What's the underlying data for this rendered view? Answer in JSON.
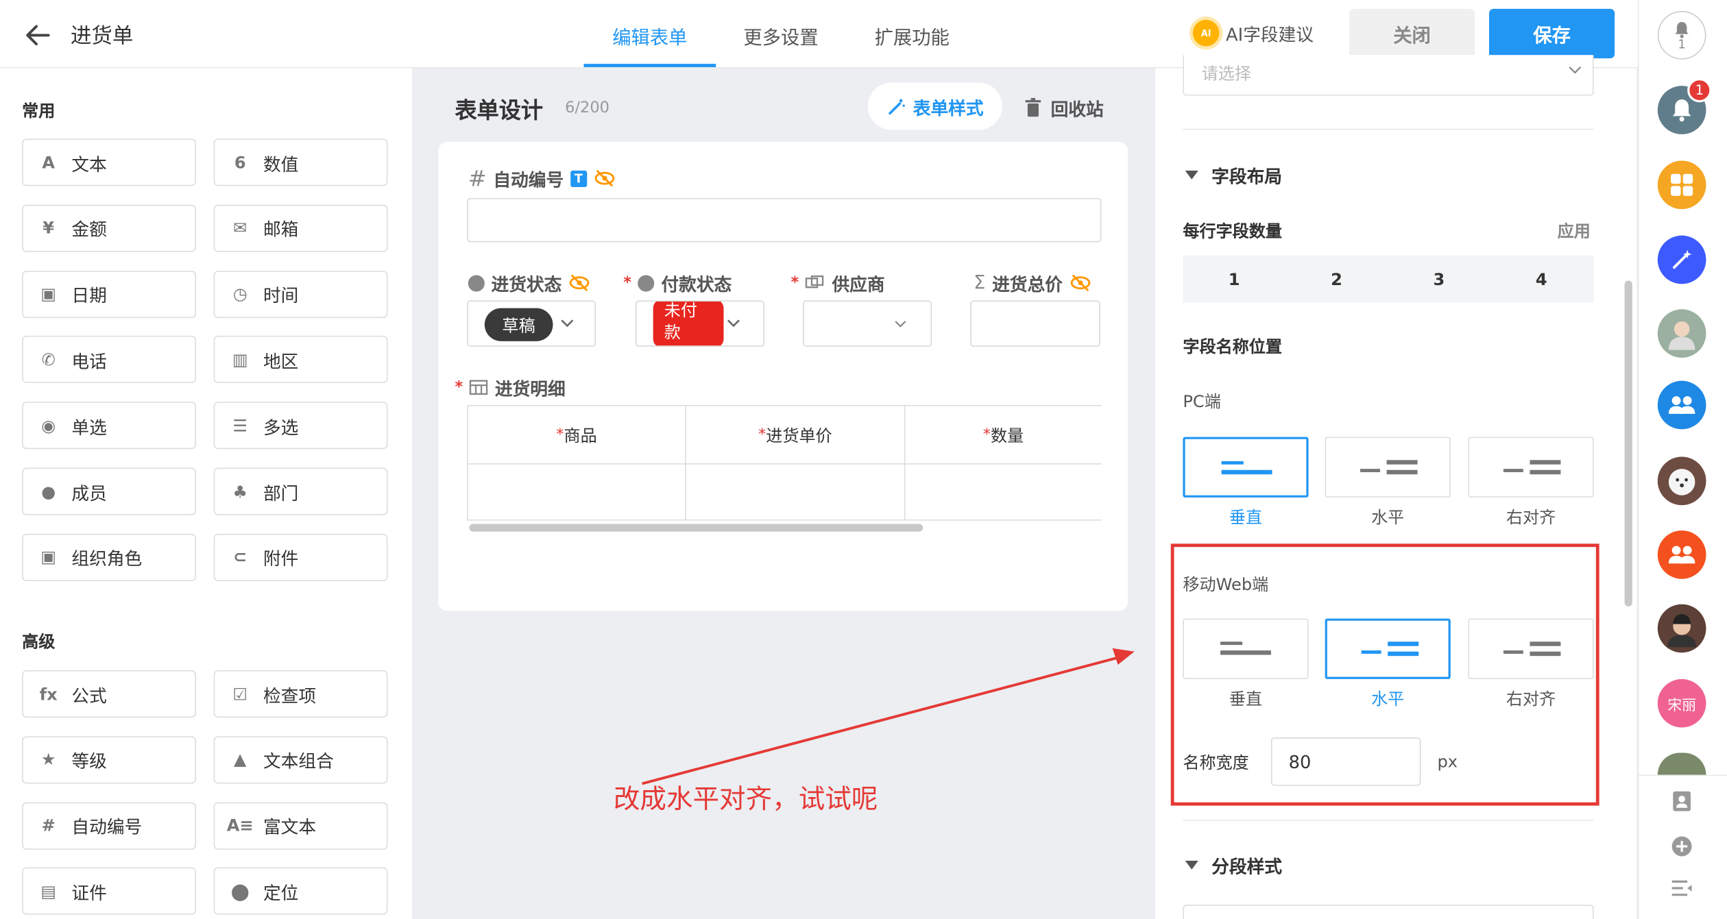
{
  "header": {
    "title": "进货单",
    "tabs": [
      "编辑表单",
      "更多设置",
      "扩展功能"
    ],
    "active_tab": 0,
    "ai_suggest": "AI字段建议",
    "close_label": "关闭",
    "save_label": "保存",
    "ai_badge": "AI"
  },
  "left": {
    "common_title": "常用",
    "common_items": [
      {
        "label": "文本",
        "icon": "text-icon",
        "glyph": "A"
      },
      {
        "label": "数值",
        "icon": "number-icon",
        "glyph": "6"
      },
      {
        "label": "金额",
        "icon": "currency-icon",
        "glyph": "¥"
      },
      {
        "label": "邮箱",
        "icon": "mail-icon",
        "glyph": "✉"
      },
      {
        "label": "日期",
        "icon": "calendar-icon",
        "glyph": "▣"
      },
      {
        "label": "时间",
        "icon": "clock-icon",
        "glyph": "◷"
      },
      {
        "label": "电话",
        "icon": "phone-icon",
        "glyph": "✆"
      },
      {
        "label": "地区",
        "icon": "map-icon",
        "glyph": "▥"
      },
      {
        "label": "单选",
        "icon": "radio-icon",
        "glyph": "◉"
      },
      {
        "label": "多选",
        "icon": "multi-select-icon",
        "glyph": "☰"
      },
      {
        "label": "成员",
        "icon": "member-icon",
        "glyph": "●"
      },
      {
        "label": "部门",
        "icon": "department-icon",
        "glyph": "♣"
      },
      {
        "label": "组织角色",
        "icon": "org-role-icon",
        "glyph": "▣"
      },
      {
        "label": "附件",
        "icon": "attachment-icon",
        "glyph": "⊂"
      }
    ],
    "advanced_title": "高级",
    "advanced_items": [
      {
        "label": "公式",
        "icon": "formula-icon",
        "glyph": "fx"
      },
      {
        "label": "检查项",
        "icon": "checkbox-icon",
        "glyph": "☑"
      },
      {
        "label": "等级",
        "icon": "star-icon",
        "glyph": "★"
      },
      {
        "label": "文本组合",
        "icon": "text-combo-icon",
        "glyph": "▲"
      },
      {
        "label": "自动编号",
        "icon": "hash-icon",
        "glyph": "#"
      },
      {
        "label": "富文本",
        "icon": "rich-text-icon",
        "glyph": "A≡"
      },
      {
        "label": "证件",
        "icon": "id-card-icon",
        "glyph": "▤"
      },
      {
        "label": "定位",
        "icon": "location-icon",
        "glyph": "⬤"
      }
    ]
  },
  "center": {
    "title": "表单设计",
    "count": "6/200",
    "style_btn": "表单样式",
    "recycle_btn": "回收站",
    "fields": {
      "auto_number": "自动编号",
      "t_badge": "T",
      "purchase_status": "进货状态",
      "purchase_status_value": "草稿",
      "payment_status": "付款状态",
      "payment_status_value": "未付款",
      "supplier": "供应商",
      "total_price": "进货总价",
      "detail": "进货明细",
      "required_mark": "*"
    },
    "table_headers": [
      "商品",
      "进货单价",
      "数量"
    ]
  },
  "right": {
    "select_placeholder": "请选择",
    "field_layout_title": "字段布局",
    "per_row_label": "每行字段数量",
    "apply_label": "应用",
    "per_row_options": [
      "1",
      "2",
      "3",
      "4"
    ],
    "name_position_title": "字段名称位置",
    "pc_label": "PC端",
    "pc_options": [
      "垂直",
      "水平",
      "右对齐"
    ],
    "pc_selected": 0,
    "mobile_label": "移动Web端",
    "mobile_options": [
      "垂直",
      "水平",
      "右对齐"
    ],
    "mobile_selected": 1,
    "name_width_label": "名称宽度",
    "name_width_value": "80",
    "name_width_unit": "px",
    "section_style_title": "分段样式"
  },
  "sidebar": {
    "bell_count": "1",
    "notification_badge": "1",
    "user_label": "宋丽"
  },
  "annotation": {
    "text": "改成水平对齐，试试呢"
  },
  "colors": {
    "primary": "#2196f3",
    "danger": "#e53935",
    "draft_chip": "#3a3a3a",
    "unpaid_chip": "#e8251e"
  }
}
